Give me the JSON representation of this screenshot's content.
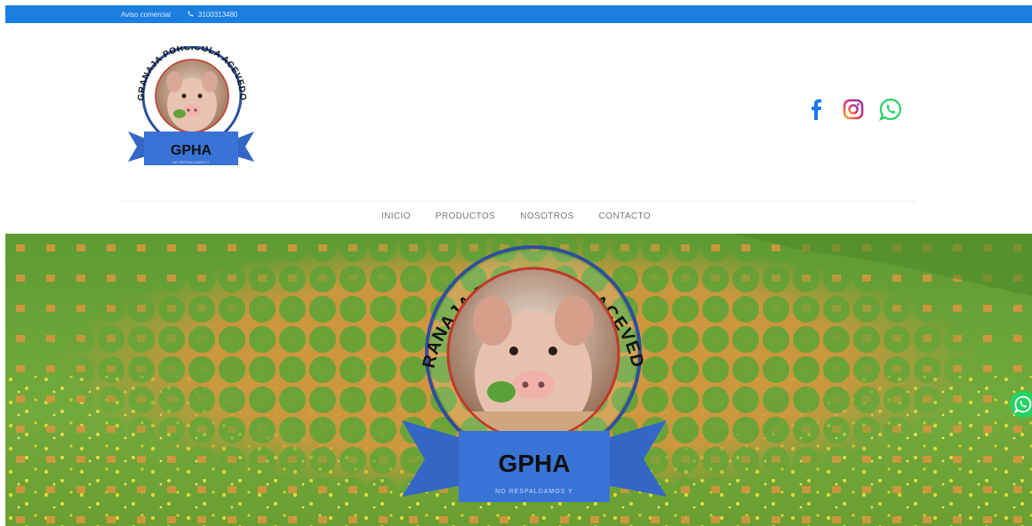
{
  "topbar": {
    "notice": "Aviso comercial",
    "phone": "3100313480",
    "phone_icon": "phone-icon",
    "bg_color": "#1a7fe0"
  },
  "header": {
    "logo": {
      "arc_text": "GRANAJA PORCICOLA ACEVEDO",
      "ribbon_text": "GPHA",
      "tagline": "NO RESPALDAMOS Y"
    },
    "social": [
      {
        "name": "facebook",
        "icon": "facebook-icon",
        "color": "#1877f2"
      },
      {
        "name": "instagram",
        "icon": "instagram-icon",
        "color": "#c13584"
      },
      {
        "name": "whatsapp",
        "icon": "whatsapp-icon",
        "color": "#25d366"
      }
    ]
  },
  "nav": {
    "items": [
      "INICIO",
      "PRODUCTOS",
      "NOSOTROS",
      "CONTACTO"
    ]
  },
  "hero": {
    "logo": {
      "arc_text": "GRANAJA PORCICOLA ACEVEDO",
      "ribbon_text": "GPHA",
      "tagline": "NO RESPALDAMOS Y"
    },
    "pattern_color": "#d4963e",
    "grass_color": "#6fa33a"
  },
  "floating": {
    "icon": "whatsapp-icon"
  }
}
